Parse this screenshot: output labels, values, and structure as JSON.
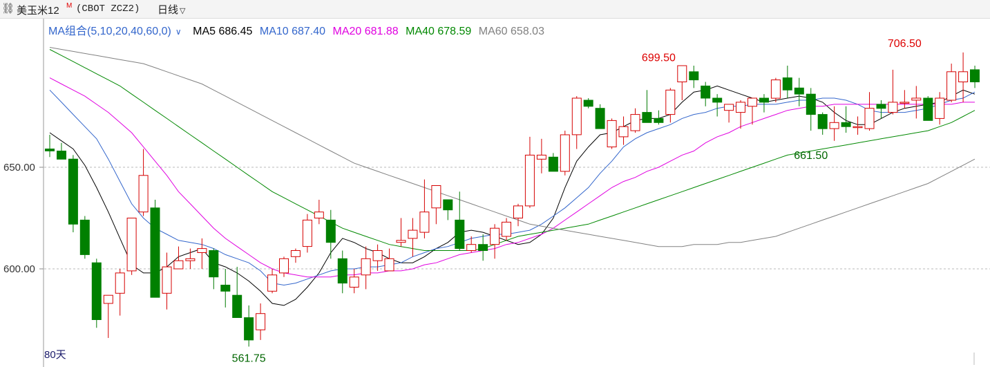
{
  "toolbar": {
    "symbol_name": "美玉米12",
    "contract_flag": "M",
    "symbol_code": "(CBOT ZCZ2)",
    "period": "日线",
    "link_icon": "link-icon",
    "dropdown_icon": "chevron-down-icon"
  },
  "ma_legend": {
    "combo_label": "MA组合(5,10,20,40,60,0)",
    "items": [
      {
        "label": "MA5 686.45",
        "color": "#000000"
      },
      {
        "label": "MA10 687.40",
        "color": "#3366cc"
      },
      {
        "label": "MA20 681.88",
        "color": "#e000e0"
      },
      {
        "label": "MA40 678.59",
        "color": "#008800"
      },
      {
        "label": "MA60 658.03",
        "color": "#808080"
      }
    ]
  },
  "days_label": "80天",
  "chart_data": {
    "type": "candlestick",
    "y_ticks": [
      {
        "value": 650,
        "label": "650.00"
      },
      {
        "value": 600,
        "label": "600.00"
      }
    ],
    "annotations": [
      {
        "label": "699.50",
        "index": 52,
        "value": 699.5,
        "color": "#dd0000",
        "pos": "above"
      },
      {
        "label": "706.50",
        "index": 73,
        "value": 706.5,
        "color": "#dd0000",
        "pos": "above"
      },
      {
        "label": "661.50",
        "index": 65,
        "value": 661.5,
        "color": "#006600",
        "pos": "below"
      },
      {
        "label": "561.75",
        "index": 17,
        "value": 561.75,
        "color": "#006600",
        "pos": "below"
      }
    ],
    "candles": [
      [
        659,
        666,
        655,
        658
      ],
      [
        658,
        662,
        654,
        654
      ],
      [
        654,
        656,
        618,
        622
      ],
      [
        624,
        626,
        605,
        607
      ],
      [
        603,
        605,
        571,
        575
      ],
      [
        583,
        586,
        566,
        587
      ],
      [
        588,
        600,
        577,
        598
      ],
      [
        599,
        625,
        597,
        625
      ],
      [
        628,
        659,
        626,
        646
      ],
      [
        630,
        634,
        587,
        586
      ],
      [
        588,
        608,
        580,
        601
      ],
      [
        600,
        611,
        600,
        604
      ],
      [
        604,
        610,
        600,
        605
      ],
      [
        608,
        615,
        600,
        610
      ],
      [
        609,
        610,
        590,
        596
      ],
      [
        592,
        600,
        581,
        589
      ],
      [
        587,
        601,
        578,
        576
      ],
      [
        576,
        582,
        561.75,
        565
      ],
      [
        570,
        583,
        565,
        578
      ],
      [
        589,
        600,
        588,
        597
      ],
      [
        598,
        606,
        596,
        605
      ],
      [
        606,
        610,
        603,
        609
      ],
      [
        611,
        627,
        608,
        624
      ],
      [
        625,
        634,
        622,
        628
      ],
      [
        624,
        629,
        605,
        613
      ],
      [
        605,
        609,
        588,
        593
      ],
      [
        591,
        600,
        588,
        596
      ],
      [
        597,
        611,
        590,
        605
      ],
      [
        604,
        612,
        599,
        609
      ],
      [
        599,
        610,
        599,
        605
      ],
      [
        613,
        625,
        611,
        614
      ],
      [
        615,
        625,
        606,
        619
      ],
      [
        618,
        644,
        615,
        628
      ],
      [
        630,
        639,
        622,
        641
      ],
      [
        634,
        633,
        624,
        629
      ],
      [
        624,
        638,
        609,
        610
      ],
      [
        609,
        616,
        608,
        612
      ],
      [
        612,
        617,
        604,
        609
      ],
      [
        612,
        622,
        605,
        620
      ],
      [
        616,
        625,
        614,
        623
      ],
      [
        625,
        632,
        621,
        631
      ],
      [
        631,
        665,
        630,
        656
      ],
      [
        654,
        664,
        647,
        656
      ],
      [
        655,
        657,
        648,
        648
      ],
      [
        648,
        668,
        646,
        666
      ],
      [
        666,
        685,
        659,
        684
      ],
      [
        683,
        684,
        679,
        680
      ],
      [
        679,
        681,
        669,
        669
      ],
      [
        660,
        674,
        659,
        673
      ],
      [
        665,
        675,
        661,
        670
      ],
      [
        668,
        679,
        667,
        676
      ],
      [
        677,
        688,
        675,
        672
      ],
      [
        674,
        678,
        671,
        672
      ],
      [
        676,
        689,
        672,
        688
      ],
      [
        692,
        697,
        683,
        700
      ],
      [
        697,
        700,
        689,
        693
      ],
      [
        690,
        692,
        680,
        684
      ],
      [
        684,
        686,
        675,
        682
      ],
      [
        678,
        680,
        672,
        681
      ],
      [
        677,
        683,
        669,
        682
      ],
      [
        680,
        684,
        671,
        684
      ],
      [
        684,
        686,
        677,
        682
      ],
      [
        684,
        694,
        682,
        693
      ],
      [
        694,
        700,
        684,
        688
      ],
      [
        689,
        694,
        680,
        686
      ],
      [
        686,
        689,
        668,
        676
      ],
      [
        676,
        677,
        666,
        669
      ],
      [
        669,
        680,
        663,
        672
      ],
      [
        672,
        680,
        667,
        670
      ],
      [
        670,
        675,
        666,
        670
      ],
      [
        669,
        687,
        668,
        679
      ],
      [
        681,
        683,
        674,
        679
      ],
      [
        677,
        698,
        676,
        682
      ],
      [
        682,
        688,
        679,
        682
      ],
      [
        683,
        690,
        674,
        684
      ],
      [
        684,
        685,
        676,
        673
      ],
      [
        674,
        687,
        671,
        684
      ],
      [
        683,
        701,
        682,
        697
      ],
      [
        692,
        706.5,
        682,
        697
      ],
      [
        698,
        700,
        689,
        692
      ]
    ],
    "ma_series": [
      {
        "name": "MA5",
        "color": "#000000",
        "values": [
          667,
          663,
          659,
          651,
          640,
          628,
          615,
          602,
          598,
          598,
          601,
          606,
          608,
          610,
          603,
          601,
          598,
          594,
          589,
          583,
          582,
          585,
          591,
          598,
          608,
          615,
          613,
          610,
          608,
          605,
          603,
          603,
          606,
          610,
          613,
          618,
          619,
          618,
          616,
          614,
          612,
          613,
          617,
          625,
          640,
          653,
          660,
          666,
          667,
          670,
          673,
          674,
          674,
          676,
          682,
          687,
          688,
          690,
          688,
          686,
          684,
          682,
          683,
          684,
          685,
          684,
          682,
          677,
          673,
          671,
          671,
          674,
          677,
          679,
          680,
          681,
          682,
          685,
          688,
          686
        ]
      },
      {
        "name": "MA10",
        "color": "#3366cc",
        "values": [
          688,
          682,
          676,
          670,
          664,
          654,
          643,
          632,
          625,
          620,
          617,
          614,
          613,
          612,
          610,
          607,
          605,
          603,
          599,
          593,
          592,
          593,
          595,
          597,
          599,
          600,
          600,
          601,
          601,
          602,
          603,
          606,
          608,
          610,
          611,
          613,
          615,
          616,
          617,
          617,
          618,
          619,
          622,
          626,
          630,
          635,
          640,
          647,
          653,
          660,
          664,
          667,
          669,
          671,
          674,
          676,
          677,
          679,
          680,
          680,
          681,
          681,
          681,
          682,
          683,
          683,
          684,
          684,
          683,
          681,
          678,
          677,
          677,
          677,
          678,
          679,
          681,
          683,
          684,
          687
        ]
      },
      {
        "name": "MA20",
        "color": "#e000e0",
        "values": [
          694,
          691,
          688,
          685,
          681,
          677,
          672,
          667,
          660,
          653,
          646,
          638,
          632,
          626,
          620,
          615,
          611,
          607,
          603,
          600,
          598,
          597,
          596,
          596,
          596,
          597,
          597,
          598,
          598,
          599,
          599,
          600,
          602,
          603,
          605,
          607,
          608,
          609,
          610,
          612,
          613,
          615,
          617,
          620,
          624,
          628,
          632,
          636,
          640,
          643,
          645,
          648,
          650,
          653,
          656,
          658,
          662,
          665,
          667,
          670,
          672,
          674,
          676,
          678,
          679,
          680,
          680,
          681,
          681,
          681,
          681,
          681,
          681,
          681,
          681,
          681,
          681,
          681,
          682,
          682
        ]
      },
      {
        "name": "MA40",
        "color": "#008800",
        "values": [
          708,
          705,
          702,
          699,
          696,
          693,
          690,
          686,
          682,
          678,
          674,
          670,
          666,
          662,
          658,
          654,
          650,
          646,
          642,
          638,
          635,
          632,
          629,
          626,
          623,
          620,
          618,
          616,
          614,
          612,
          611,
          610,
          609,
          609,
          609,
          609,
          609,
          610,
          612,
          614,
          616,
          617,
          618,
          619,
          620,
          621,
          622,
          624,
          626,
          628,
          630,
          632,
          634,
          636,
          638,
          640,
          642,
          644,
          646,
          648,
          650,
          652,
          654,
          656,
          657,
          658,
          659,
          660,
          661,
          662,
          663,
          664,
          665,
          666,
          667,
          668,
          670,
          672,
          675,
          678
        ]
      },
      {
        "name": "MA60",
        "color": "#808080",
        "values": [
          709,
          708,
          707,
          706,
          705,
          704,
          703,
          702,
          701,
          699,
          697,
          695,
          693,
          691,
          688,
          685,
          682,
          679,
          676,
          673,
          670,
          667,
          664,
          661,
          658,
          655,
          652,
          650,
          648,
          646,
          644,
          642,
          640,
          638,
          636,
          634,
          632,
          630,
          628,
          626,
          624,
          622,
          621,
          620,
          619,
          618,
          617,
          616,
          615,
          614,
          613,
          612,
          611,
          611,
          611,
          612,
          612,
          612,
          613,
          613,
          614,
          615,
          616,
          618,
          620,
          622,
          624,
          626,
          628,
          630,
          632,
          634,
          636,
          638,
          640,
          642,
          645,
          648,
          651,
          654
        ]
      }
    ]
  }
}
